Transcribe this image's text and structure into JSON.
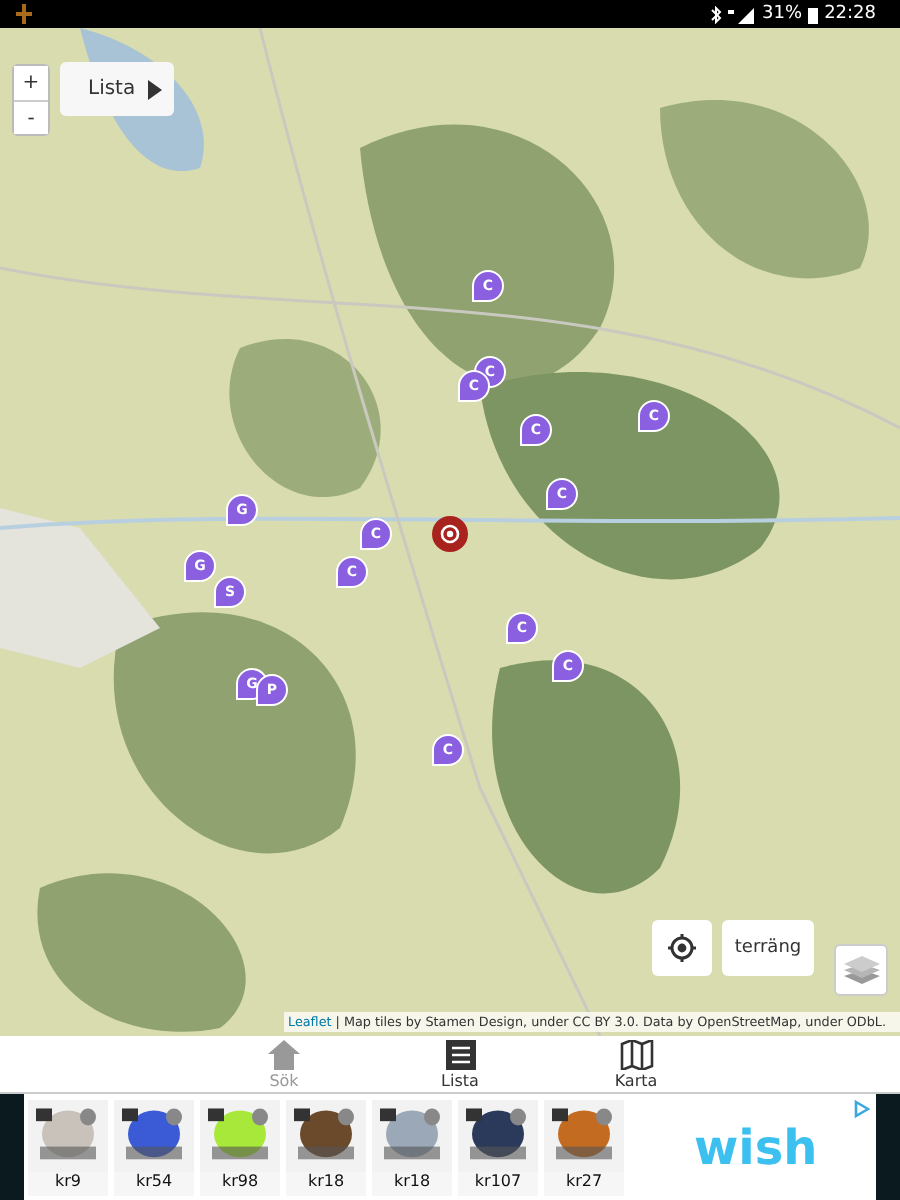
{
  "status_bar": {
    "battery": "31%",
    "time": "22:28"
  },
  "map": {
    "zoom": [
      "+",
      "-"
    ],
    "list_button": {
      "label": "Lista"
    },
    "markers": [
      {
        "label": "C"
      },
      {
        "label": "C"
      },
      {
        "label": "C"
      },
      {
        "label": "C"
      },
      {
        "label": "C"
      },
      {
        "label": "C"
      },
      {
        "label": "C"
      },
      {
        "label": "C"
      },
      {
        "label": "C"
      },
      {
        "label": "C"
      },
      {
        "label": "C"
      },
      {
        "label": "G"
      },
      {
        "label": "G"
      },
      {
        "label": "S"
      },
      {
        "label": "G"
      },
      {
        "label": "P"
      }
    ],
    "terrain_button": {
      "label": "terräng"
    },
    "attribution": {
      "link": "Leaflet",
      "text": " | Map tiles by Stamen Design, under CC BY 3.0. Data by OpenStreetMap, under ODbL."
    }
  },
  "nav": [
    {
      "label": "Sök",
      "disabled": true
    },
    {
      "label": "Lista",
      "disabled": false
    },
    {
      "label": "Karta",
      "disabled": false
    }
  ],
  "ad": {
    "items": [
      {
        "price": "kr9"
      },
      {
        "price": "kr54"
      },
      {
        "price": "kr98"
      },
      {
        "price": "kr18"
      },
      {
        "price": "kr18"
      },
      {
        "price": "kr107"
      },
      {
        "price": "kr27"
      }
    ],
    "brand": "wish"
  }
}
